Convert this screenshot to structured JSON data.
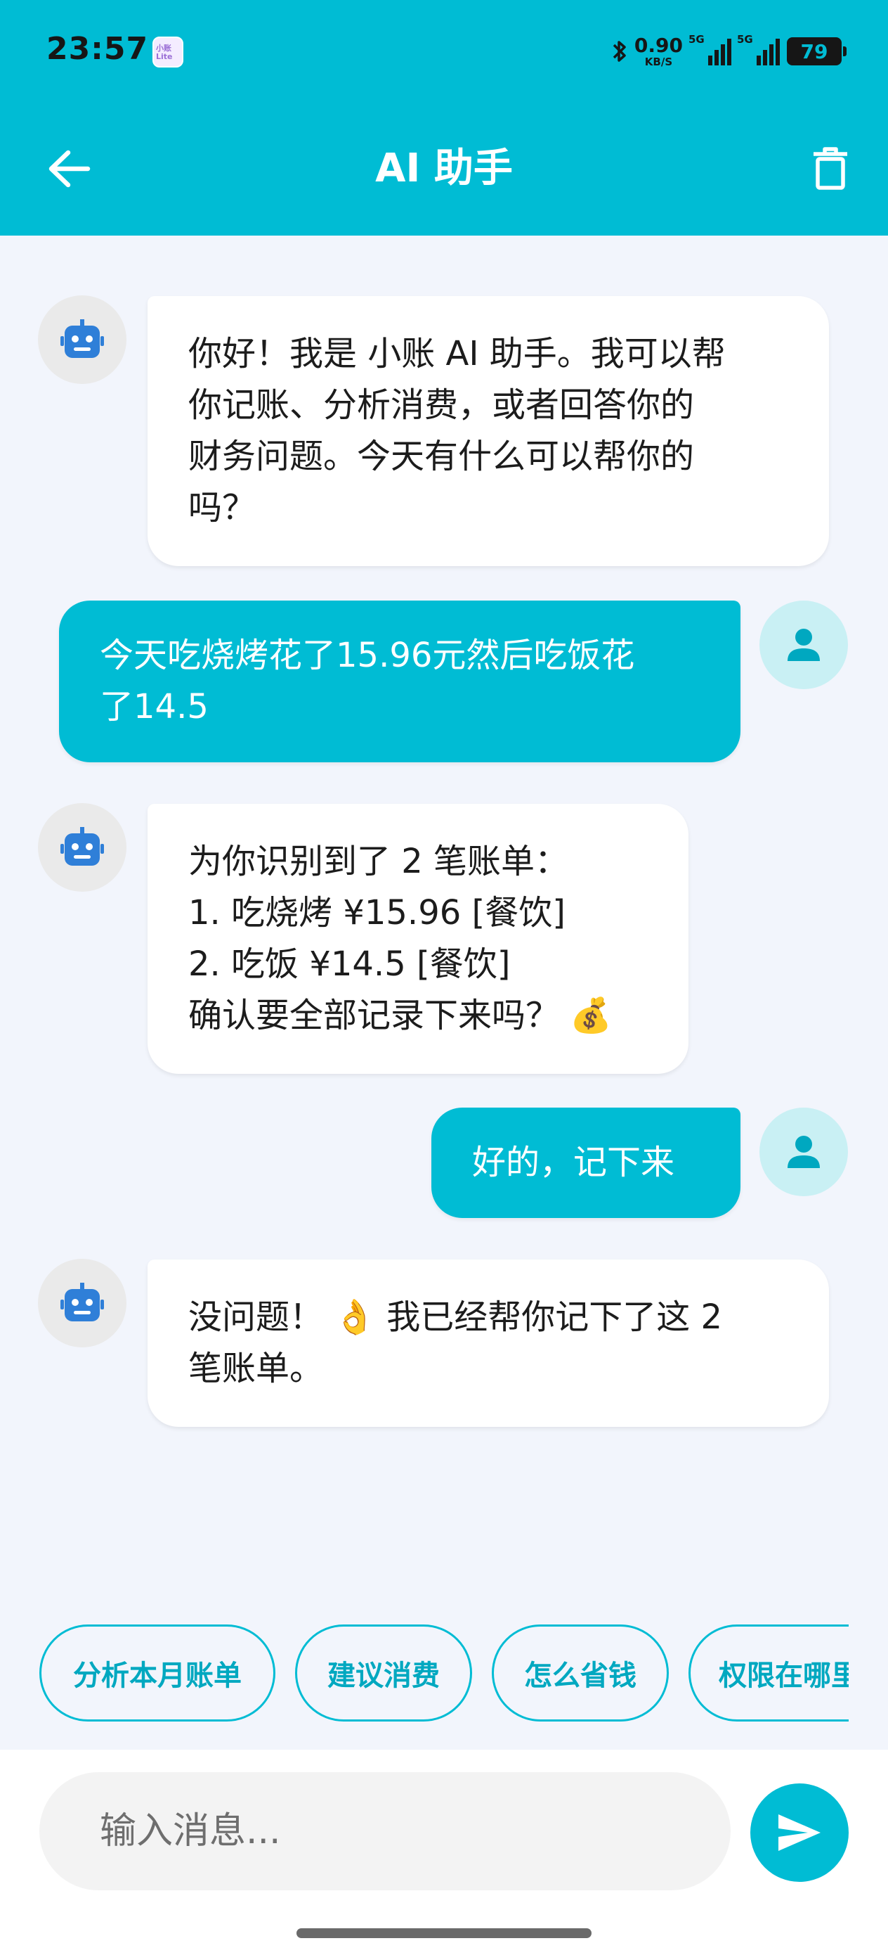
{
  "status_bar": {
    "time": "23:57",
    "app_icon_text": "小账 Lite",
    "net_speed_value": "0.90",
    "net_speed_unit": "KB/S",
    "signal1_label": "5G",
    "signal2_label": "5G",
    "battery": "79"
  },
  "app_bar": {
    "title": "AI 助手",
    "back_icon": "arrow-left-icon",
    "delete_icon": "trash-icon"
  },
  "messages": [
    {
      "role": "bot",
      "lines": [
        "你好！我是 小账 AI 助手。我可以帮",
        "你记账、分析消费，或者回答你的",
        "财务问题。今天有什么可以帮你的",
        "吗？"
      ]
    },
    {
      "role": "user",
      "lines": [
        "今天吃烧烤花了15.96元然后吃饭花",
        "了14.5"
      ]
    },
    {
      "role": "bot",
      "lines": [
        "为你识别到了 2 笔账单：",
        "1. 吃烧烤 ¥15.96 [餐饮]",
        "2. 吃饭 ¥14.5 [餐饮]",
        "确认要全部记录下来吗？ 💰"
      ]
    },
    {
      "role": "user",
      "lines": [
        "好的，记下来"
      ]
    },
    {
      "role": "bot",
      "lines": [
        "没问题！ 👌 我已经帮你记下了这 2",
        "笔账单。"
      ]
    }
  ],
  "quick_replies": [
    "分析本月账单",
    "建议消费",
    "怎么省钱",
    "权限在哪里"
  ],
  "input": {
    "placeholder": "输入消息...",
    "value": ""
  },
  "colors": {
    "accent": "#00bcd4",
    "background": "#f2f5fc",
    "bot_bubble": "#ffffff",
    "bot_icon": "#2f7fd8"
  }
}
